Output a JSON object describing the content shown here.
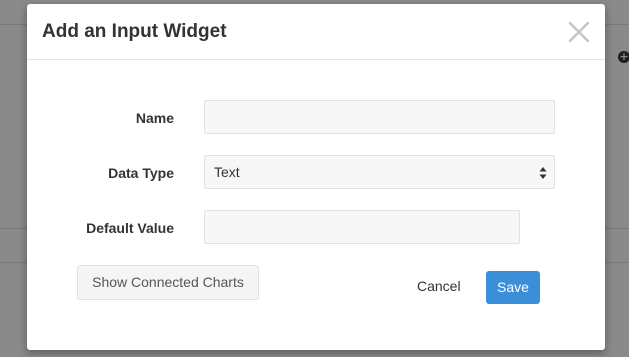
{
  "modal": {
    "title": "Add an Input Widget"
  },
  "form": {
    "name_label": "Name",
    "name_value": "",
    "data_type_label": "Data Type",
    "data_type_value": "Text",
    "default_value_label": "Default Value",
    "default_value_value": ""
  },
  "actions": {
    "show_connected_charts": "Show Connected Charts",
    "cancel": "Cancel",
    "save": "Save"
  },
  "icons": {
    "close": "close-icon",
    "select_arrows": "select-arrows-icon",
    "background_add": "plus-circle-icon"
  },
  "colors": {
    "primary": "#3a8fd8",
    "overlay": "#8a8a8a"
  }
}
